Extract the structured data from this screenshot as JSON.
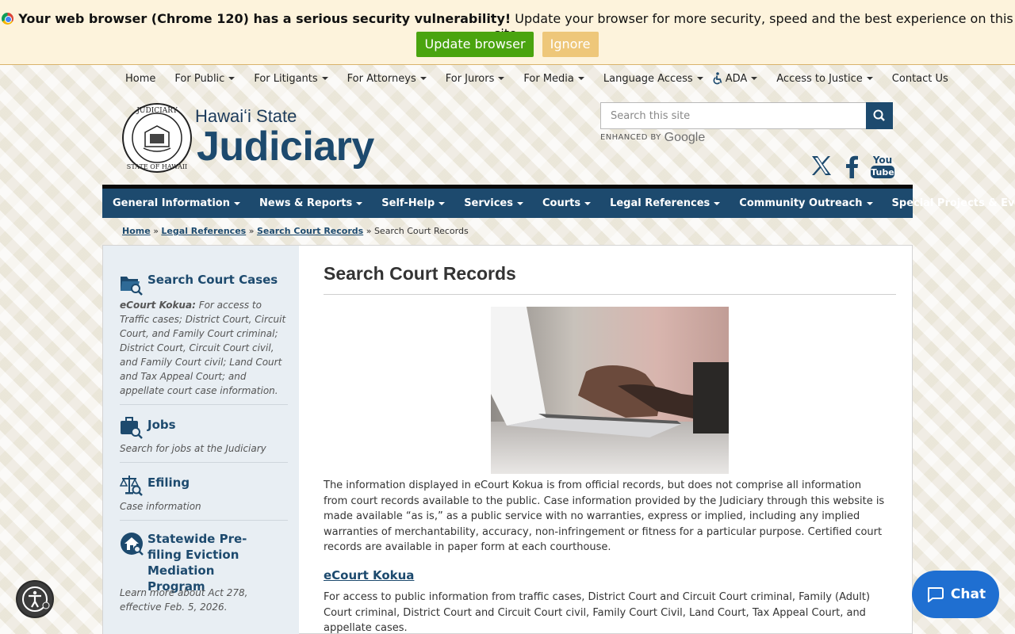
{
  "banner": {
    "bold_text": "Your web browser (Chrome 120) has a serious security vulnerability!",
    "text": " Update your browser for more security, speed and the best experience on this site.",
    "update_label": "Update browser",
    "ignore_label": "Ignore"
  },
  "topnav": {
    "items": [
      "Home",
      "For Public",
      "For Litigants",
      "For Attorneys",
      "For Jurors",
      "For Media",
      "Language Access",
      "ADA",
      "Access to Justice",
      "Contact Us"
    ]
  },
  "logo": {
    "subtitle": "Hawaiʻi State",
    "title": "Judiciary"
  },
  "search": {
    "placeholder": "Search this site",
    "enhanced_label": "ENHANCED BY",
    "google_label": "Google"
  },
  "mainnav": {
    "items": [
      "General Information",
      "News & Reports",
      "Self-Help",
      "Services",
      "Courts",
      "Legal References",
      "Community Outreach",
      "Special Projects & Events"
    ]
  },
  "breadcrumb": {
    "home": "Home",
    "legal": "Legal References",
    "search": "Search Court Records",
    "current": "Search Court Records",
    "sep": "»"
  },
  "sidebar": {
    "items": [
      {
        "title": "Search Court Cases",
        "desc_bold": "eCourt Kokua:",
        "desc": " For access to Traffic cases; District Court, Circuit Court, and Family Court criminal; District Court, Circuit Court civil, and Family Court civil; Land Court and Tax Appeal Court; and appellate court case information."
      },
      {
        "title": "Jobs",
        "desc": "Search for jobs at the Judiciary"
      },
      {
        "title": "Efiling",
        "desc": "Case information"
      },
      {
        "title": "Statewide Pre-filing Eviction Mediation Program",
        "desc": "Learn more about Act 278, effective Feb. 5, 2026."
      }
    ]
  },
  "main": {
    "title": "Search Court Records",
    "intro": "The information displayed in eCourt Kokua is from official records, but does not comprise all information from court records available to the public. Case information provided by the Judiciary through this website is made available “as is,” as a public service with no warranties, express or implied, including any implied warranties of merchantability, accuracy, non-infringement or fitness for a particular purpose. Certified court records are available in paper form at each courthouse.",
    "ecourt_link": "eCourt Kokua",
    "ecourt_desc": "For access to public information from traffic cases, District Court and Circuit Court criminal, Family (Adult) Court criminal, District Court and Circuit Court civil, Family Court Civil, Land Court, Tax Appeal Court, and appellate cases."
  },
  "chat": {
    "label": "Chat"
  },
  "colors": {
    "brand": "#1d4a6e",
    "update": "#4aa40f",
    "ignore": "#eec77a",
    "chat": "#1f6fd1"
  },
  "icons": {
    "banner": "chrome-icon",
    "search": "search-icon",
    "social": [
      "x-twitter-icon",
      "facebook-icon",
      "youtube-icon"
    ],
    "sidebar": [
      "folder-search-icon",
      "briefcase-search-icon",
      "scales-search-icon",
      "house-search-icon"
    ],
    "accessibility": "accessibility-icon",
    "chat": "chat-bubble-icon"
  }
}
